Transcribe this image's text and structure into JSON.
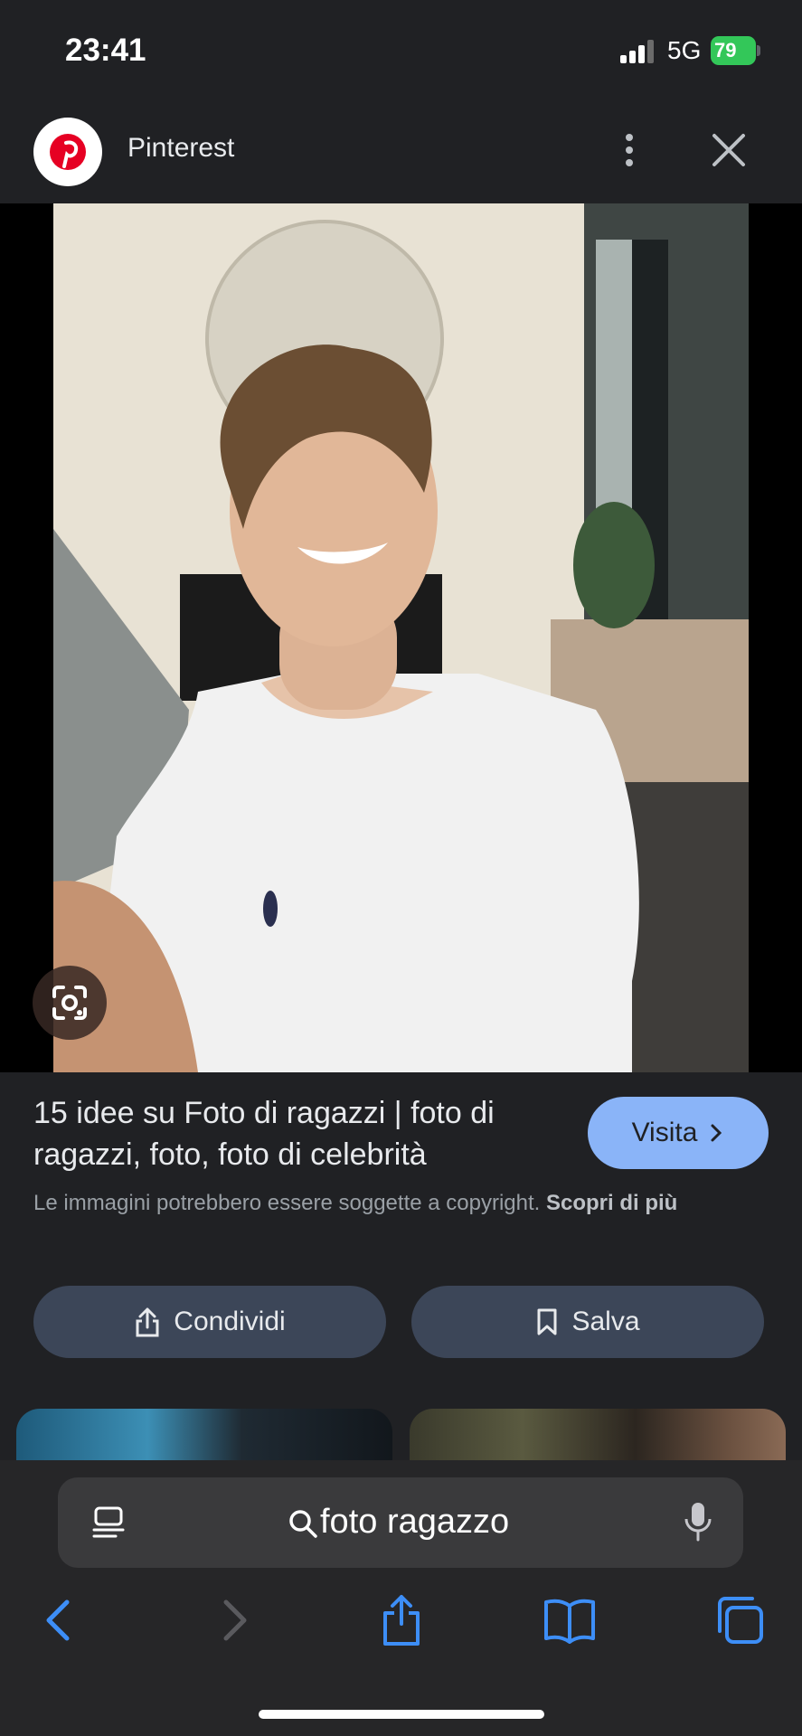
{
  "status_bar": {
    "time": "23:41",
    "network": "5G",
    "battery": "79"
  },
  "header": {
    "site_name": "Pinterest",
    "logo_icon": "pinterest-logo",
    "more_icon": "more-vertical-icon",
    "close_icon": "close-icon"
  },
  "image": {
    "description_icon": "google-lens-icon"
  },
  "result": {
    "title": "15 idee su Foto di ragazzi | foto di ragazzi, foto, foto di celebrità",
    "visit_label": "Visita",
    "copyright_text": "Le immagini potrebbero essere soggette a copyright.",
    "learn_more": "Scopri di più"
  },
  "actions": {
    "share_label": "Condividi",
    "save_label": "Salva"
  },
  "browser": {
    "address": "foto ragazzo"
  },
  "colors": {
    "background": "#202124",
    "accent": "#8ab4f8",
    "pill": "#3c4658",
    "safari_blue": "#3d8ef7",
    "battery": "#33c759"
  }
}
